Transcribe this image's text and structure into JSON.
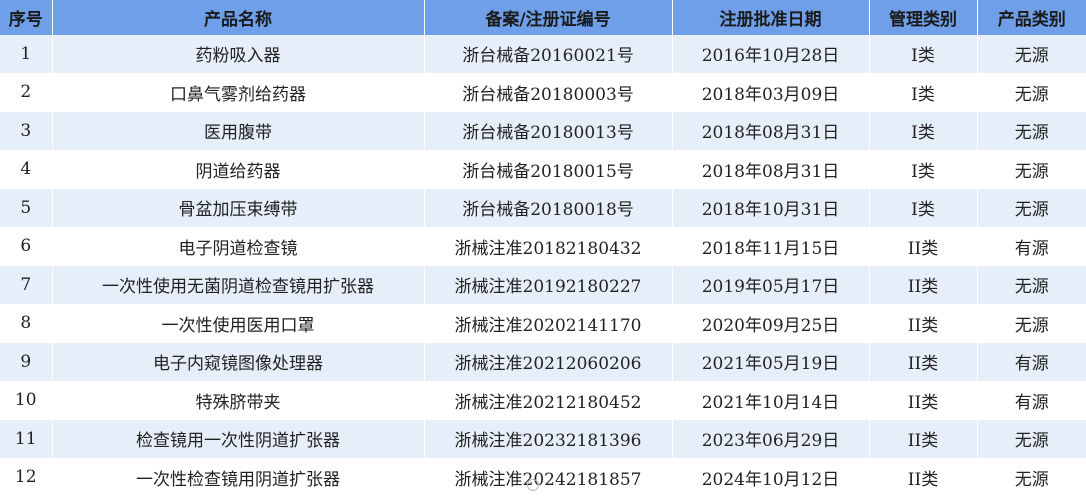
{
  "table": {
    "headers": [
      "序号",
      "产品名称",
      "备案/注册证编号",
      "注册批准日期",
      "管理类别",
      "产品类别"
    ],
    "rows": [
      [
        "1",
        "药粉吸入器",
        "浙台械备20160021号",
        "2016年10月28日",
        "I类",
        "无源"
      ],
      [
        "2",
        "口鼻气雾剂给药器",
        "浙台械备20180003号",
        "2018年03月09日",
        "I类",
        "无源"
      ],
      [
        "3",
        "医用腹带",
        "浙台械备20180013号",
        "2018年08月31日",
        "I类",
        "无源"
      ],
      [
        "4",
        "阴道给药器",
        "浙台械备20180015号",
        "2018年08月31日",
        "I类",
        "无源"
      ],
      [
        "5",
        "骨盆加压束缚带",
        "浙台械备20180018号",
        "2018年10月31日",
        "I类",
        "无源"
      ],
      [
        "6",
        "电子阴道检查镜",
        "浙械注准20182180432",
        "2018年11月15日",
        "II类",
        "有源"
      ],
      [
        "7",
        "一次性使用无菌阴道检查镜用扩张器",
        "浙械注准20192180227",
        "2019年05月17日",
        "II类",
        "无源"
      ],
      [
        "8",
        "一次性使用医用口罩",
        "浙械注准20202141170",
        "2020年09月25日",
        "II类",
        "无源"
      ],
      [
        "9",
        "电子内窥镜图像处理器",
        "浙械注准20212060206",
        "2021年05月19日",
        "II类",
        "有源"
      ],
      [
        "10",
        "特殊脐带夹",
        "浙械注准20212180452",
        "2021年10月14日",
        "II类",
        "有源"
      ],
      [
        "11",
        "检查镜用一次性阴道扩张器",
        "浙械注准20232181396",
        "2023年06月29日",
        "II类",
        "无源"
      ],
      [
        "12",
        "一次性检查镜用阴道扩张器",
        "浙械注准20242181857",
        "2024年10月12日",
        "II类",
        "无源"
      ]
    ]
  },
  "colors": {
    "header_bg": "#6f9fe8",
    "stripe_bg": "#e6eef9",
    "row_bg": "#ffffff"
  }
}
